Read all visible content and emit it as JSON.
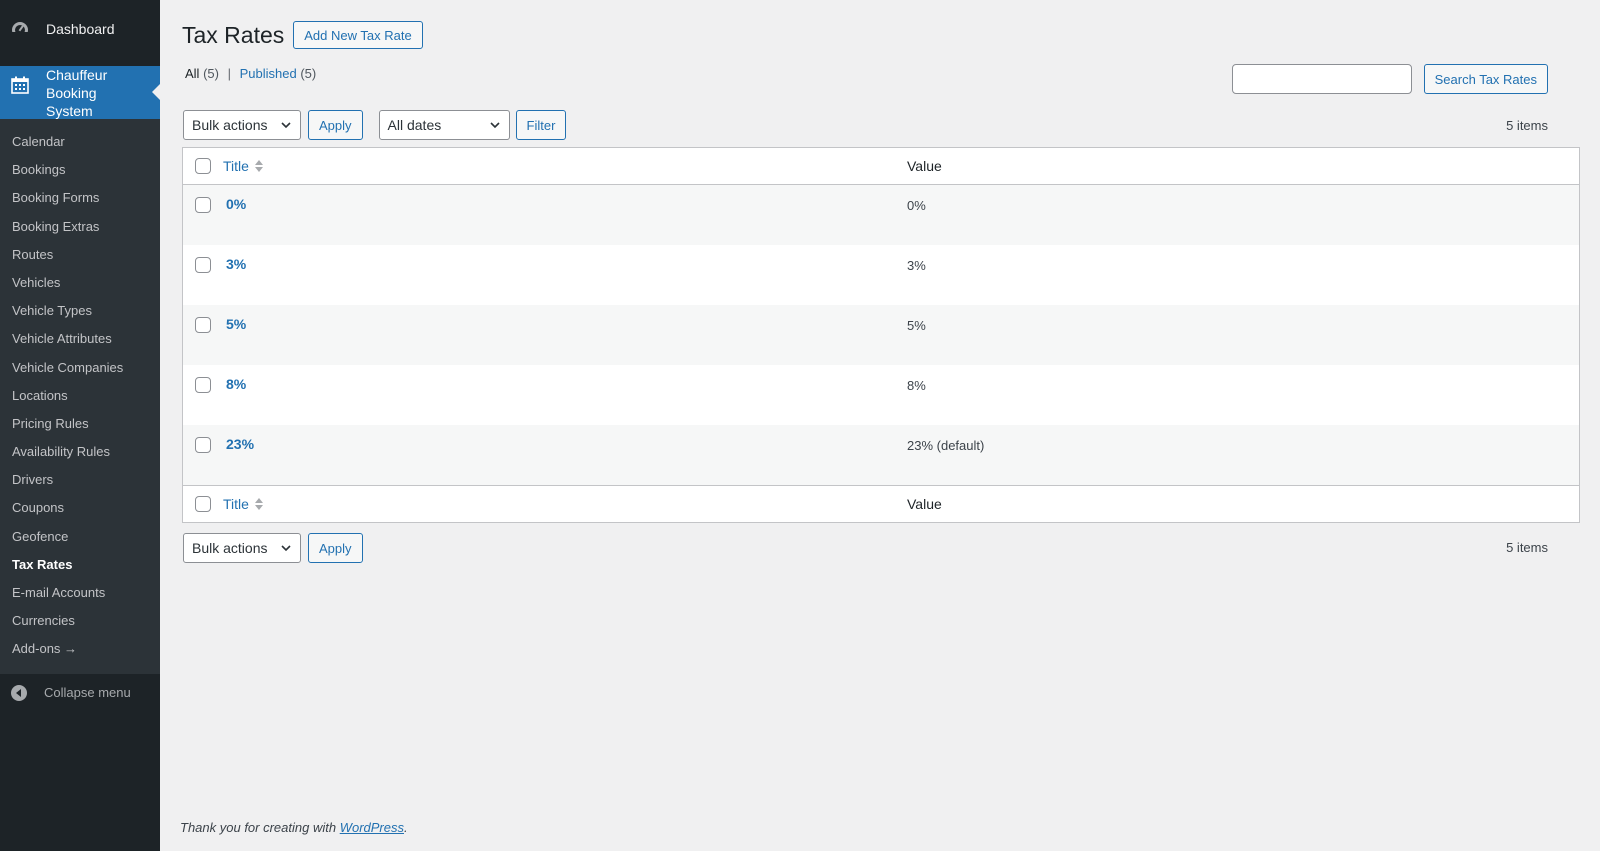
{
  "sidebar": {
    "dashboard_label": "Dashboard",
    "current_menu_label": "Chauffeur Booking System",
    "items": [
      {
        "label": "Calendar"
      },
      {
        "label": "Bookings"
      },
      {
        "label": "Booking Forms"
      },
      {
        "label": "Booking Extras"
      },
      {
        "label": "Routes"
      },
      {
        "label": "Vehicles"
      },
      {
        "label": "Vehicle Types"
      },
      {
        "label": "Vehicle Attributes"
      },
      {
        "label": "Vehicle Companies"
      },
      {
        "label": "Locations"
      },
      {
        "label": "Pricing Rules"
      },
      {
        "label": "Availability Rules"
      },
      {
        "label": "Drivers"
      },
      {
        "label": "Coupons"
      },
      {
        "label": "Geofence"
      },
      {
        "label": "Tax Rates",
        "active": true
      },
      {
        "label": "E-mail Accounts"
      },
      {
        "label": "Currencies"
      },
      {
        "label": "Add-ons →"
      }
    ],
    "collapse_label": "Collapse menu"
  },
  "header": {
    "title": "Tax Rates",
    "add_new_label": "Add New Tax Rate"
  },
  "views": {
    "all_label": "All",
    "all_count": "(5)",
    "separator": "|",
    "published_label": "Published",
    "published_count": "(5)"
  },
  "search": {
    "value": "",
    "button_label": "Search Tax Rates"
  },
  "tablenav": {
    "bulk_actions": "Bulk actions",
    "apply_label": "Apply",
    "dates_filter": "All dates",
    "filter_label": "Filter",
    "items_count": "5 items"
  },
  "table": {
    "columns": {
      "title": "Title",
      "value": "Value"
    },
    "rows": [
      {
        "title": "0%",
        "value": "0%"
      },
      {
        "title": "3%",
        "value": "3%"
      },
      {
        "title": "5%",
        "value": "5%"
      },
      {
        "title": "8%",
        "value": "8%"
      },
      {
        "title": "23%",
        "value": "23% (default)"
      }
    ]
  },
  "footer": {
    "text": "Thank you for creating with",
    "link": "WordPress",
    "suffix": "."
  },
  "colors": {
    "sidebar_bg": "#1d2327",
    "submenu_bg": "#2c3338",
    "accent": "#2271b1",
    "page_bg": "#f0f0f1"
  }
}
